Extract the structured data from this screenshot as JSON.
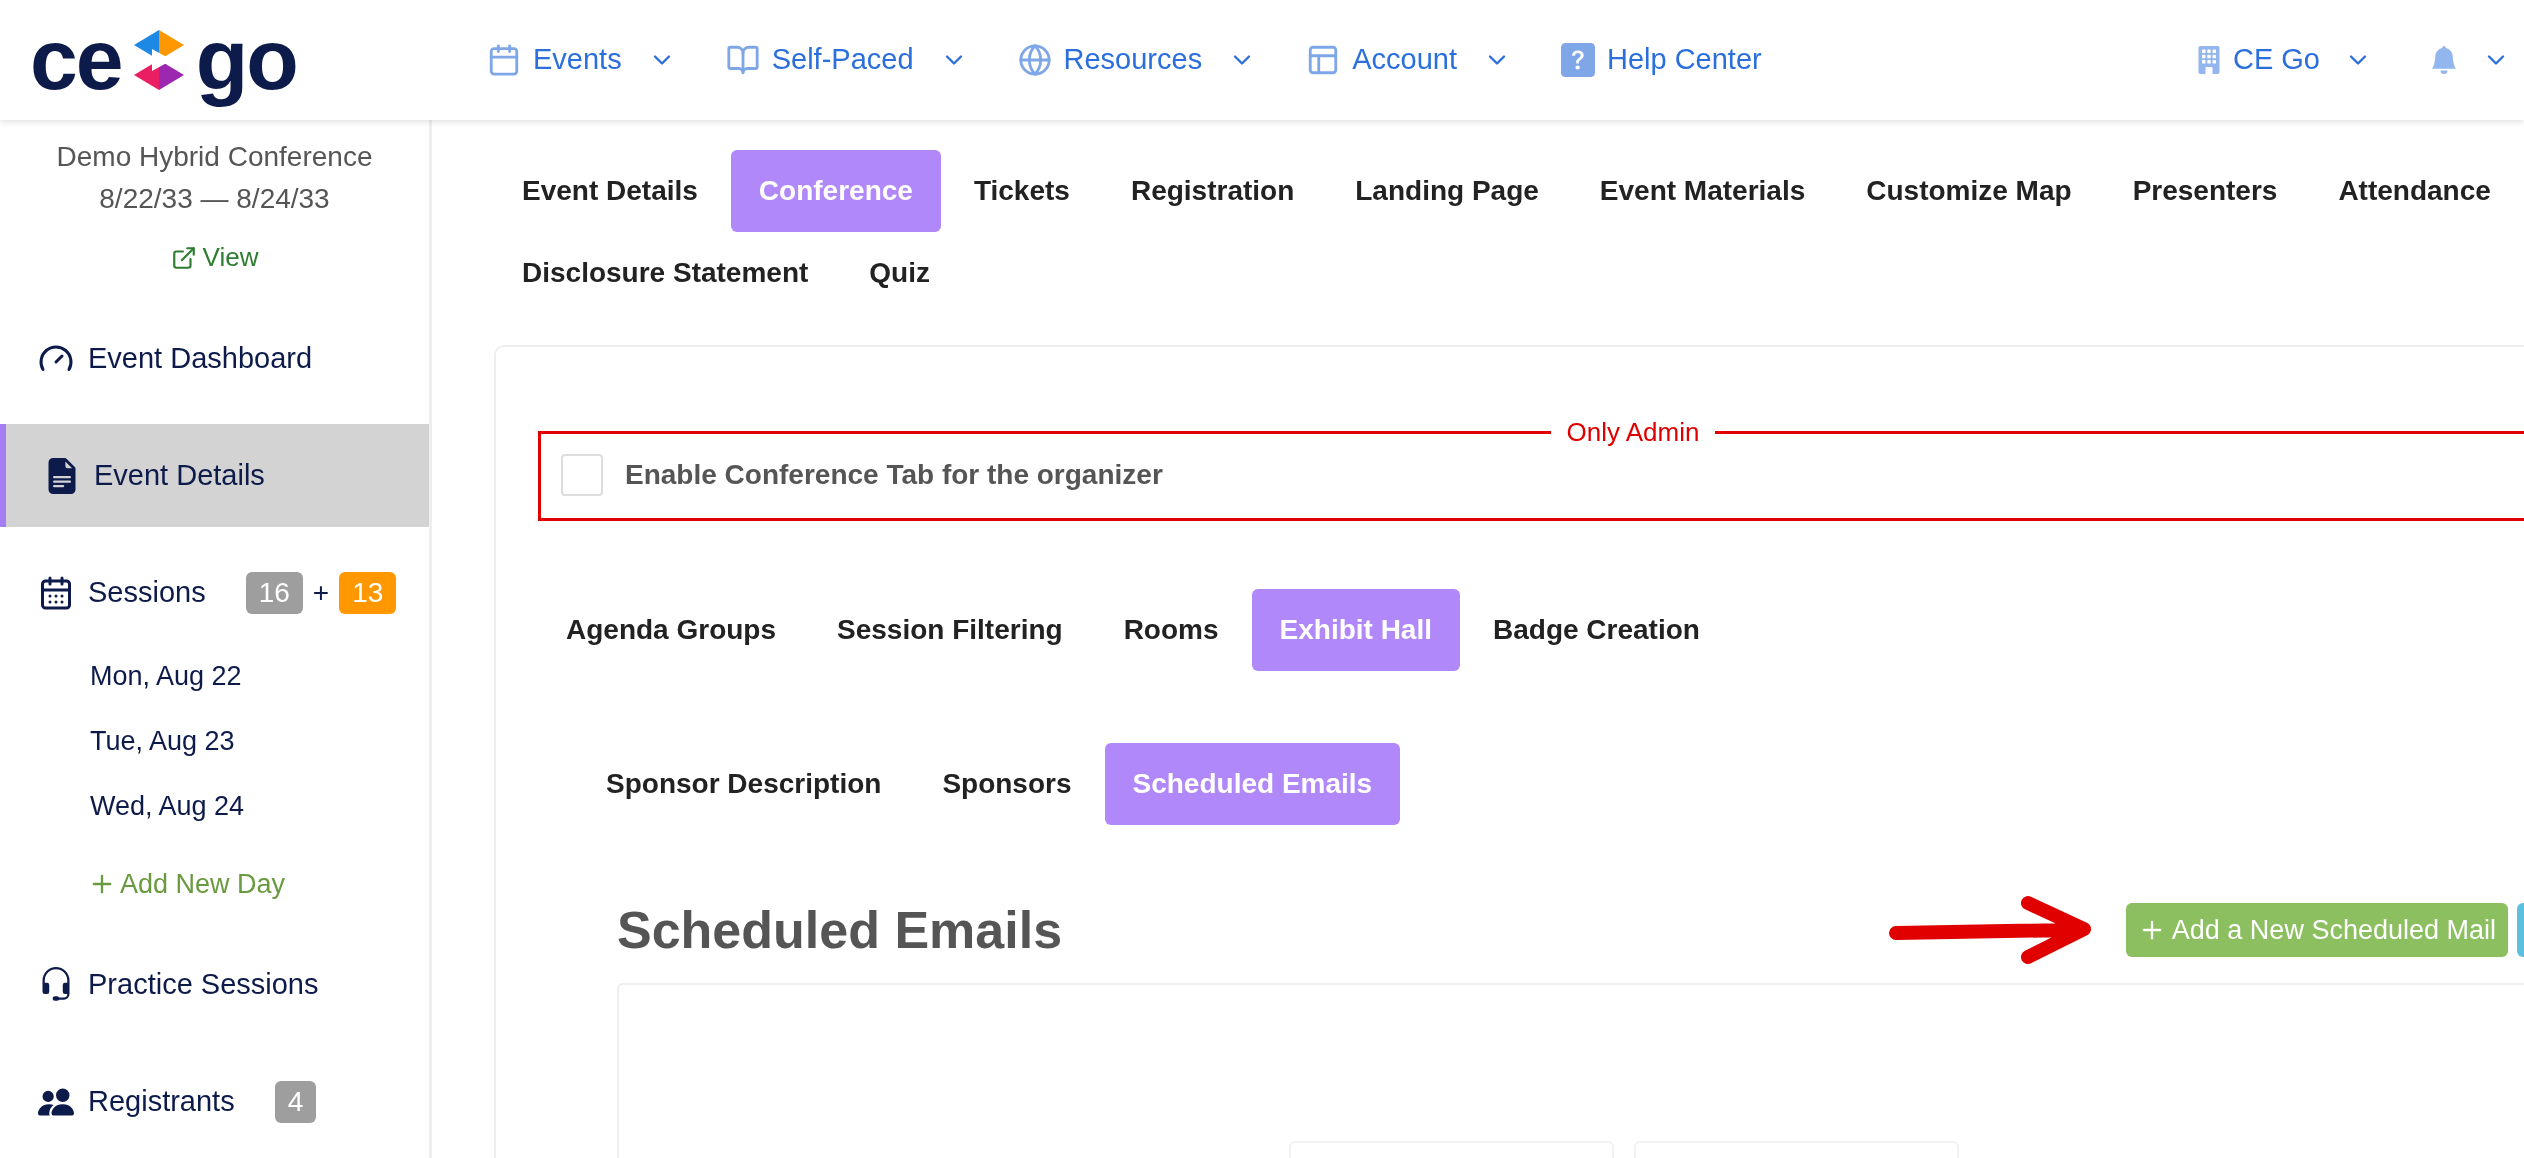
{
  "logo": {
    "left": "ce",
    "right": "go"
  },
  "nav": [
    {
      "label": "Events",
      "has_menu": true
    },
    {
      "label": "Self-Paced",
      "has_menu": true
    },
    {
      "label": "Resources",
      "has_menu": true
    },
    {
      "label": "Account",
      "has_menu": true
    },
    {
      "label": "Help Center",
      "has_menu": false
    }
  ],
  "org_menu": {
    "label": "CE Go"
  },
  "event": {
    "title": "Demo Hybrid Conference",
    "dates": "8/22/33 — 8/24/33",
    "view_link": "View"
  },
  "sidebar": {
    "items": [
      {
        "label": "Event Dashboard",
        "selected": false
      },
      {
        "label": "Event Details",
        "selected": true
      },
      {
        "label": "Sessions",
        "selected": false,
        "badges": [
          {
            "text": "16",
            "color": "#9e9e9e"
          },
          {
            "text": "+",
            "kind": "separator"
          },
          {
            "text": "13",
            "color": "#ff9800"
          }
        ],
        "children": [
          {
            "label": "Mon, Aug 22",
            "kind": "day"
          },
          {
            "label": "Tue, Aug 23",
            "kind": "day"
          },
          {
            "label": "Wed, Aug 24",
            "kind": "day"
          },
          {
            "label": "Add New Day",
            "kind": "add"
          }
        ]
      },
      {
        "label": "Practice Sessions",
        "selected": false
      },
      {
        "label": "Registrants",
        "selected": false,
        "badges": [
          {
            "text": "4",
            "color": "#9e9e9e"
          }
        ]
      }
    ]
  },
  "tab_rows": [
    [
      {
        "label": "Event Details",
        "selected": false
      },
      {
        "label": "Conference",
        "selected": true
      },
      {
        "label": "Tickets",
        "selected": false
      },
      {
        "label": "Registration",
        "selected": false
      },
      {
        "label": "Landing Page",
        "selected": false
      },
      {
        "label": "Event Materials",
        "selected": false
      },
      {
        "label": "Customize Map",
        "selected": false
      },
      {
        "label": "Presenters",
        "selected": false
      },
      {
        "label": "Attendance",
        "selected": false
      }
    ],
    [
      {
        "label": "Disclosure Statement",
        "selected": false
      },
      {
        "label": "Quiz",
        "selected": false
      }
    ]
  ],
  "admin_box": {
    "legend": "Only Admin",
    "checkbox": {
      "label": "Enable Conference Tab for the organizer",
      "checked": false
    }
  },
  "subtabs": [
    {
      "label": "Agenda Groups",
      "selected": false
    },
    {
      "label": "Session Filtering",
      "selected": false
    },
    {
      "label": "Rooms",
      "selected": false
    },
    {
      "label": "Exhibit Hall",
      "selected": true
    },
    {
      "label": "Badge Creation",
      "selected": false
    }
  ],
  "exhibit_tabs": [
    {
      "label": "Sponsor Description",
      "selected": false
    },
    {
      "label": "Sponsors",
      "selected": false
    },
    {
      "label": "Scheduled Emails",
      "selected": true
    }
  ],
  "section": {
    "heading": "Scheduled Emails",
    "add_button": "Add a New Scheduled Mail"
  }
}
